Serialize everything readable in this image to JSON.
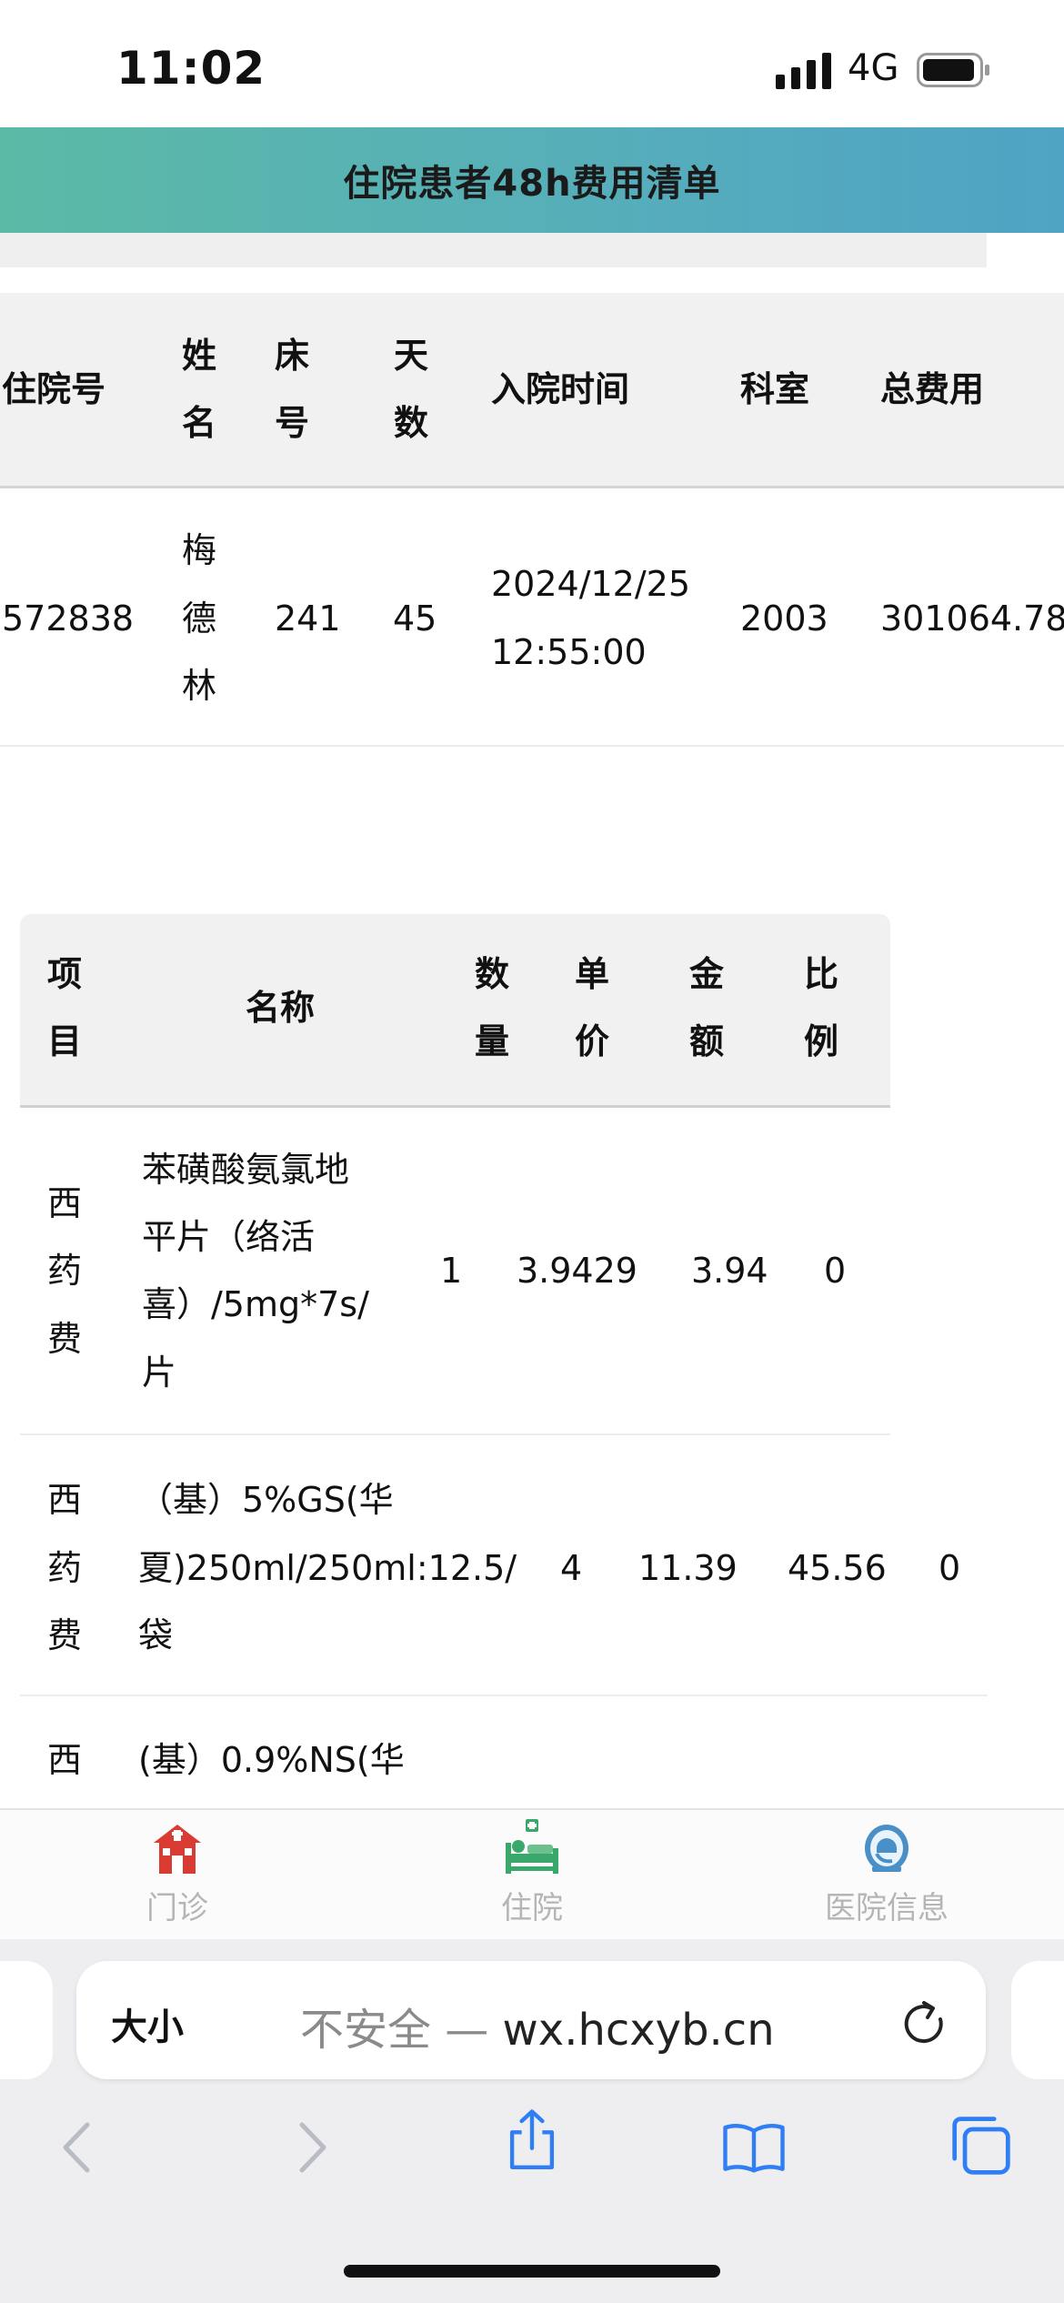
{
  "status_bar": {
    "time": "11:02",
    "network": "4G"
  },
  "header": {
    "title": "住院患者48h费用清单"
  },
  "patient_table": {
    "headers": {
      "admission_no": "住院号",
      "name_1": "姓",
      "name_2": "名",
      "bed_1": "床",
      "bed_2": "号",
      "days_1": "天",
      "days_2": "数",
      "admit_time": "入院时间",
      "department": "科室",
      "total": "总费用"
    },
    "row": {
      "admission_no": "572838",
      "name_1": "梅",
      "name_2": "德",
      "name_3": "林",
      "bed": "241",
      "days": "45",
      "admit_date": "2024/12/25",
      "admit_clock": "12:55:00",
      "department": "2003",
      "total": "301064.78"
    }
  },
  "items_table": {
    "headers": {
      "category_1": "项",
      "category_2": "目",
      "name": "名称",
      "qty_1": "数",
      "qty_2": "量",
      "price_1": "单",
      "price_2": "价",
      "amount_1": "金",
      "amount_2": "额",
      "ratio_1": "比",
      "ratio_2": "例"
    },
    "rows": [
      {
        "category_1": "西",
        "category_2": "药",
        "category_3": "费",
        "name_1": "苯磺酸氨氯地",
        "name_2": "平片（络活",
        "name_3": "喜）/5mg*7s/",
        "name_4": "片",
        "qty": "1",
        "price": "3.9429",
        "amount": "3.94",
        "ratio": "0"
      },
      {
        "category_1": "西",
        "category_2": "药",
        "category_3": "费",
        "name_1": "（基）5%GS(华",
        "name_2": "夏)250ml/250ml:12.5/",
        "name_3": "袋",
        "qty": "4",
        "price": "11.39",
        "amount": "45.56",
        "ratio": "0"
      },
      {
        "category_1": "西",
        "name_1": "(基）0.9%NS(华"
      }
    ]
  },
  "tab_bar": {
    "tabs": [
      {
        "label": "门诊",
        "icon": "clinic-icon"
      },
      {
        "label": "住院",
        "icon": "hospital-bed-icon"
      },
      {
        "label": "医院信息",
        "icon": "hospital-info-icon"
      }
    ]
  },
  "safari": {
    "text_size": "大小",
    "url_insecure": "不安全 —",
    "url_domain": "wx.hcxyb.cn"
  },
  "colors": {
    "header_start": "#5bbaa6",
    "header_end": "#4fa3c4",
    "clinic_icon": "#d93a32",
    "hospital_icon": "#3aa86a",
    "info_icon": "#4a90c8",
    "safari_blue": "#2f7ef6"
  }
}
